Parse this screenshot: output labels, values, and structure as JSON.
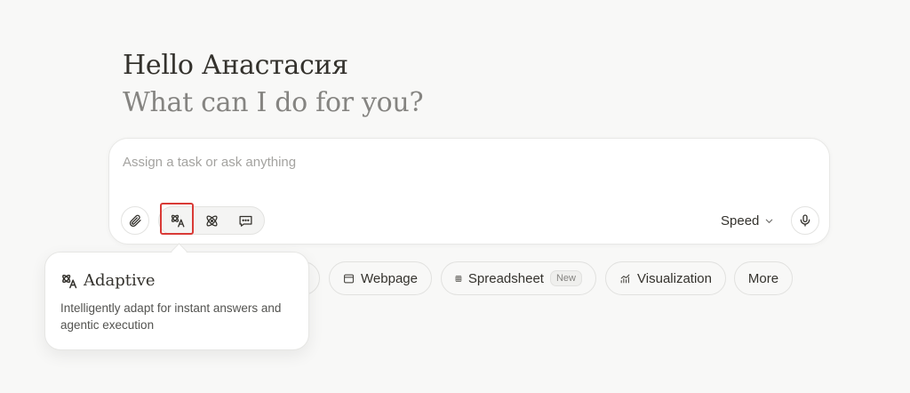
{
  "greeting": "Hello Анастасия",
  "subtitle": "What can I do for you?",
  "composer": {
    "placeholder": "Assign a task or ask anything",
    "value": "",
    "speed_label": "Speed"
  },
  "modes": [
    {
      "name": "Adaptive",
      "icon": "adaptive-icon",
      "selected": true
    },
    {
      "name": "Agent",
      "icon": "atom-icon",
      "selected": false
    },
    {
      "name": "Chat",
      "icon": "chat-icon",
      "selected": false
    }
  ],
  "chips": {
    "webpage": "Webpage",
    "spreadsheet": "Spreadsheet",
    "spreadsheet_badge": "New",
    "visualization": "Visualization",
    "more": "More"
  },
  "tooltip": {
    "title": "Adaptive",
    "description": "Intelligently adapt for instant answers and agentic execution"
  },
  "colors": {
    "background": "#f8f8f7",
    "text": "#34322d",
    "muted": "#858481",
    "highlight": "#d93a36"
  }
}
